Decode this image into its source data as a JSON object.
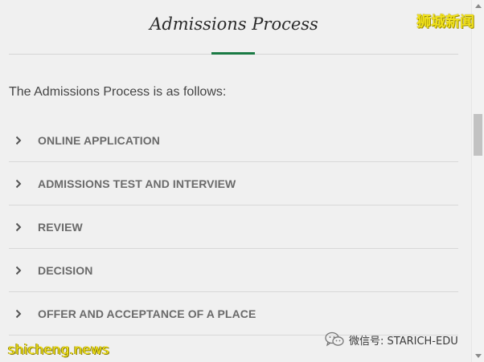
{
  "page": {
    "title": "Admissions Process",
    "intro": "The Admissions Process is as follows:"
  },
  "accordion": {
    "items": [
      {
        "label": "ONLINE APPLICATION",
        "icon": "chevron-right-icon"
      },
      {
        "label": "ADMISSIONS TEST AND INTERVIEW",
        "icon": "chevron-right-icon"
      },
      {
        "label": "REVIEW",
        "icon": "chevron-right-icon"
      },
      {
        "label": "DECISION",
        "icon": "chevron-right-icon"
      },
      {
        "label": "OFFER AND ACCEPTANCE OF A PLACE",
        "icon": "chevron-right-icon"
      }
    ]
  },
  "watermarks": {
    "top_right": "狮城新闻",
    "bottom_left": "shicheng.news",
    "wechat": "微信号: STARICH-EDU",
    "wechat_icon": "wechat-icon"
  },
  "colors": {
    "accent": "#1a7a44",
    "background": "#f0f0f0",
    "watermark": "#f2e31c"
  }
}
